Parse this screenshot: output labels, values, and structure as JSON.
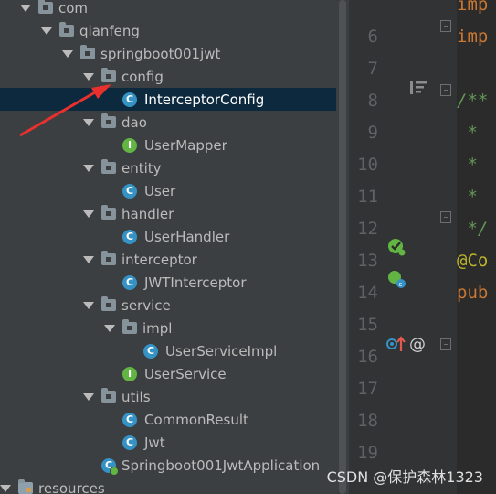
{
  "tree": {
    "items": [
      {
        "label": "com",
        "type": "package",
        "depth": 2
      },
      {
        "label": "qianfeng",
        "type": "package",
        "depth": 3
      },
      {
        "label": "springboot001jwt",
        "type": "package",
        "depth": 4
      },
      {
        "label": "config",
        "type": "package",
        "depth": 5
      },
      {
        "label": "InterceptorConfig",
        "type": "class",
        "depth": 6,
        "selected": true
      },
      {
        "label": "dao",
        "type": "package",
        "depth": 5
      },
      {
        "label": "UserMapper",
        "type": "interface",
        "depth": 6
      },
      {
        "label": "entity",
        "type": "package",
        "depth": 5
      },
      {
        "label": "User",
        "type": "class",
        "depth": 6
      },
      {
        "label": "handler",
        "type": "package",
        "depth": 5
      },
      {
        "label": "UserHandler",
        "type": "class",
        "depth": 6
      },
      {
        "label": "interceptor",
        "type": "package",
        "depth": 5
      },
      {
        "label": "JWTInterceptor",
        "type": "class",
        "depth": 6
      },
      {
        "label": "service",
        "type": "package",
        "depth": 5
      },
      {
        "label": "impl",
        "type": "package",
        "depth": 6
      },
      {
        "label": "UserServiceImpl",
        "type": "class",
        "depth": 7
      },
      {
        "label": "UserService",
        "type": "interface",
        "depth": 6
      },
      {
        "label": "utils",
        "type": "package",
        "depth": 5
      },
      {
        "label": "CommonResult",
        "type": "class",
        "depth": 6
      },
      {
        "label": "Jwt",
        "type": "class",
        "depth": 6
      },
      {
        "label": "Springboot001JwtApplication",
        "type": "app",
        "depth": 5
      },
      {
        "label": "resources",
        "type": "resources",
        "depth": 1
      }
    ]
  },
  "editor": {
    "lines": [
      {
        "number": "",
        "code": "imp",
        "style": "kw"
      },
      {
        "number": "6",
        "code": "imp",
        "style": "kw"
      },
      {
        "number": "7",
        "code": "",
        "style": "kw"
      },
      {
        "number": "8",
        "code": "/**",
        "style": "cm"
      },
      {
        "number": "9",
        "code": " *",
        "style": "cm"
      },
      {
        "number": "10",
        "code": " *",
        "style": "cm"
      },
      {
        "number": "11",
        "code": " *",
        "style": "cm"
      },
      {
        "number": "12",
        "code": " */",
        "style": "cm"
      },
      {
        "number": "13",
        "code": "@Co",
        "style": "an"
      },
      {
        "number": "14",
        "code": "pub",
        "style": "kw"
      },
      {
        "number": "15",
        "code": "",
        "style": "kw"
      },
      {
        "number": "16",
        "code": "",
        "style": "kw"
      },
      {
        "number": "17",
        "code": "",
        "style": "kw"
      },
      {
        "number": "18",
        "code": "",
        "style": "kw"
      },
      {
        "number": "19",
        "code": "",
        "style": "kw"
      }
    ]
  },
  "icons": {
    "class_letter": "C",
    "interface_letter": "I"
  },
  "annotation": {
    "arrow_color": "#e8302f"
  },
  "watermark": "CSDN @保护森林1323"
}
